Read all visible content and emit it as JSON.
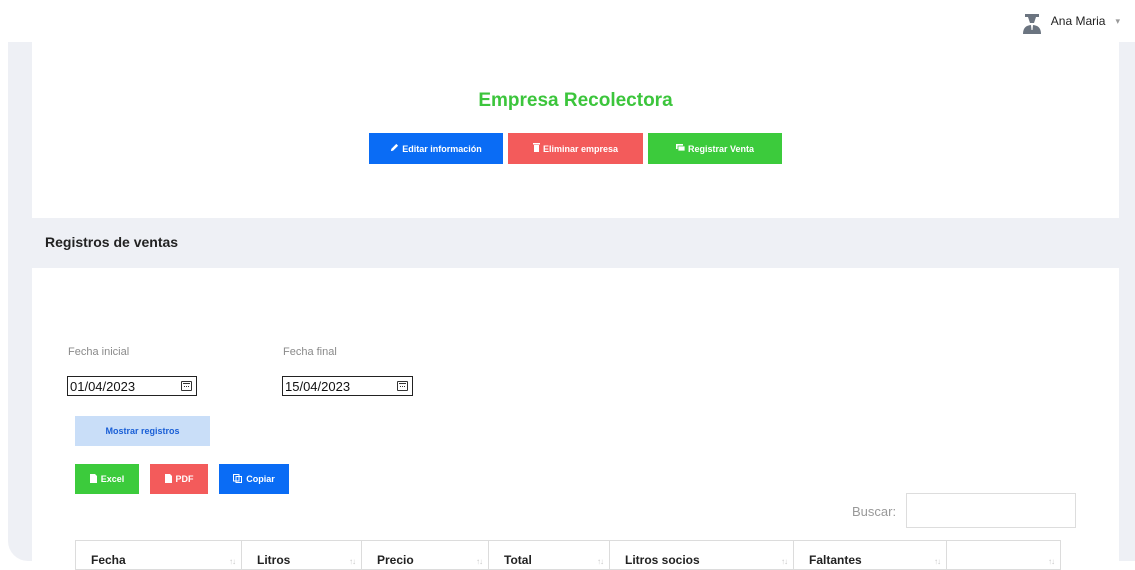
{
  "user": {
    "name": "Ana Maria"
  },
  "company": {
    "title": "Empresa Recolectora",
    "buttons": {
      "edit": "Editar información",
      "delete": "Eliminar empresa",
      "register": "Registrar Venta"
    }
  },
  "sales": {
    "section_title": "Registros de ventas",
    "start_label": "Fecha inicial",
    "start_value": "01/04/2023",
    "end_label": "Fecha final",
    "end_value": "15/04/2023",
    "show_button": "Mostrar registros",
    "export": {
      "excel": "Excel",
      "pdf": "PDF",
      "copy": "Copiar"
    },
    "search_label": "Buscar:",
    "columns": [
      "Fecha",
      "Litros",
      "Precio",
      "Total",
      "Litros socios",
      "Faltantes",
      ""
    ]
  },
  "colors": {
    "green": "#3ccb3c",
    "blue": "#0a6cf5",
    "red": "#f35b5b",
    "light_blue": "#c9def8"
  },
  "icons": [
    "user-avatar-icon",
    "pencil-icon",
    "trash-icon",
    "cash-icon",
    "calendar-icon",
    "file-icon",
    "copy-icon",
    "sort-icon"
  ]
}
